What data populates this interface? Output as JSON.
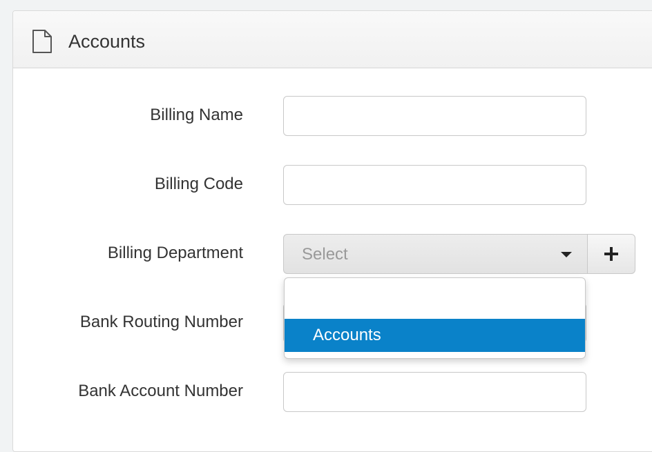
{
  "panel": {
    "title": "Accounts",
    "icon": "document-icon"
  },
  "form": {
    "billing_name": {
      "label": "Billing Name",
      "value": "",
      "placeholder": ""
    },
    "billing_code": {
      "label": "Billing Code",
      "value": "",
      "placeholder": ""
    },
    "billing_department": {
      "label": "Billing Department",
      "placeholder": "Select",
      "add_button_icon": "plus-icon",
      "options": [
        "",
        "Accounts"
      ],
      "highlighted_option": "Accounts"
    },
    "bank_routing_number": {
      "label": "Bank Routing Number",
      "value": "",
      "placeholder": ""
    },
    "bank_account_number": {
      "label": "Bank Account Number",
      "value": "",
      "placeholder": ""
    }
  },
  "colors": {
    "highlight": "#0a82c9",
    "label_text": "#333333",
    "placeholder_text": "#999999"
  }
}
